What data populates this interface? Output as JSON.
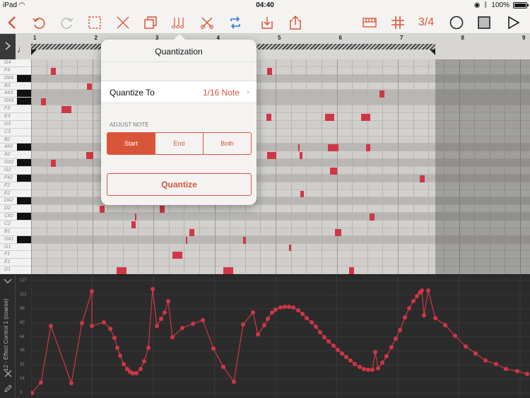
{
  "status": {
    "device": "iPad",
    "time": "04:40",
    "battery": "100%"
  },
  "toolbar": {
    "time_signature": "3/4"
  },
  "ruler": {
    "bars": [
      "1",
      "2",
      "3",
      "4",
      "5",
      "6",
      "7",
      "8",
      "9"
    ]
  },
  "keys": [
    "G4",
    "F4",
    "D#4",
    "B3",
    "A#3",
    "G#3",
    "F3",
    "E3",
    "D3",
    "C3",
    "B2",
    "A#2",
    "A2",
    "G#2",
    "G2",
    "F#2",
    "F2",
    "E2",
    "D#2",
    "D2",
    "C#2",
    "C2",
    "B1",
    "G#1",
    "G1",
    "F1",
    "E1",
    "D1"
  ],
  "popover": {
    "title": "Quantization",
    "quantize_to_label": "Quantize To",
    "quantize_to_value": "1/16 Note",
    "section_label": "ADJUST NOTE",
    "segments": [
      "Start",
      "End",
      "Both"
    ],
    "selected_segment": "Start",
    "quantize_button": "Quantize"
  },
  "lane": {
    "title": "12 - Effect Control 1 (coarse)",
    "ticks": [
      "127",
      "112",
      "96",
      "80",
      "64",
      "48",
      "32",
      "16",
      "0"
    ],
    "range": [
      0,
      127
    ]
  },
  "colors": {
    "accent": "#d9553a",
    "note": "#cf3745"
  }
}
